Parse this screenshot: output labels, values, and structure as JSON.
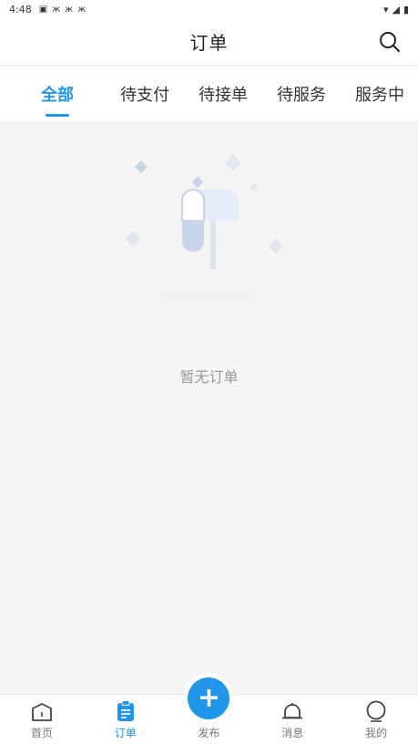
{
  "status_bar": {
    "time": "4:48"
  },
  "header": {
    "title": "订单"
  },
  "tabs": [
    {
      "label": "全部"
    },
    {
      "label": "待支付"
    },
    {
      "label": "待接单"
    },
    {
      "label": "待服务"
    },
    {
      "label": "服务中"
    }
  ],
  "empty": {
    "message": "暂无订单"
  },
  "nav": {
    "home": "首页",
    "orders": "订单",
    "publish": "发布",
    "messages": "消息",
    "mine": "我的"
  },
  "colors": {
    "accent": "#2196e8",
    "background": "#f5f5f5"
  }
}
